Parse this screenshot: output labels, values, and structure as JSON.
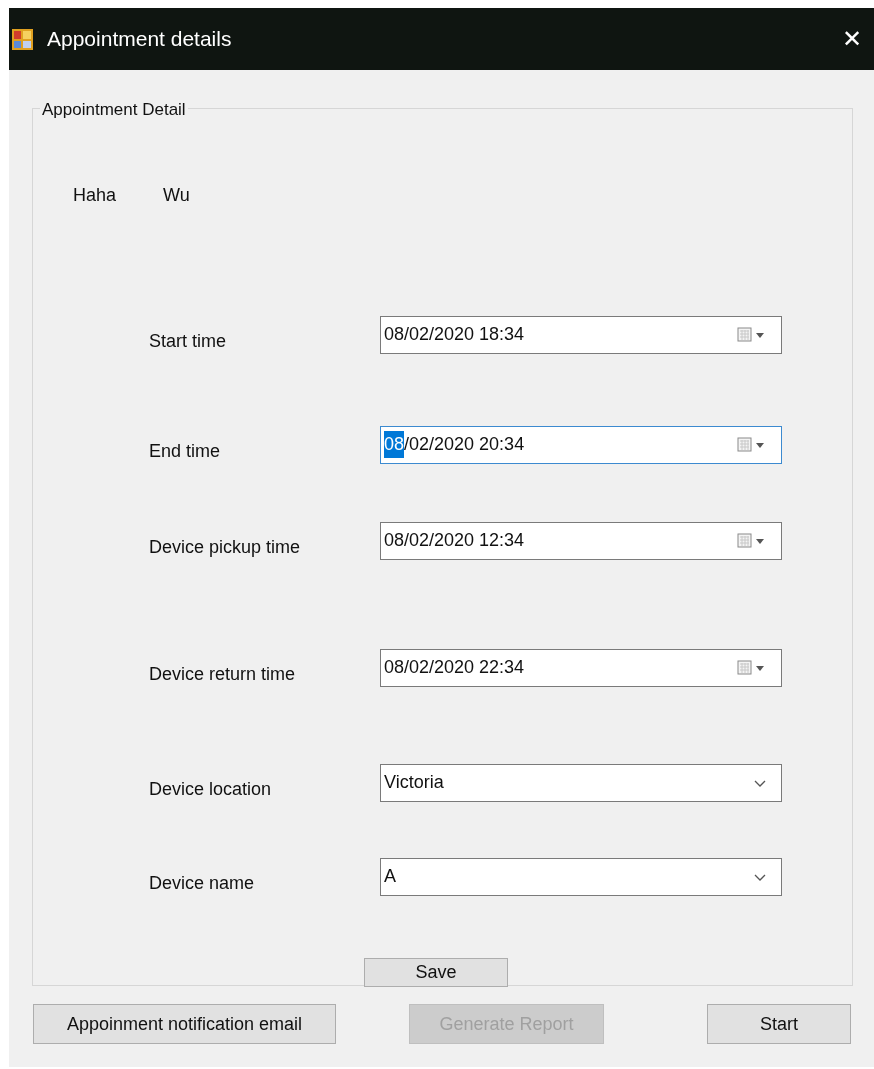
{
  "window": {
    "title": "Appointment details",
    "close": "✕"
  },
  "group": {
    "title": "Appointment Detail",
    "names": [
      "Haha",
      "Wu"
    ],
    "fields": [
      {
        "kind": "datetime",
        "label": "Start time",
        "focused": false,
        "segments": [
          {
            "text": "08/02/2020 18:34",
            "selected": false
          }
        ]
      },
      {
        "kind": "datetime",
        "label": "End time",
        "focused": true,
        "segments": [
          {
            "text": "08",
            "selected": true
          },
          {
            "text": "/02/2020 20:34",
            "selected": false
          }
        ]
      },
      {
        "kind": "datetime",
        "label": "Device pickup time",
        "focused": false,
        "segments": [
          {
            "text": "08/02/2020 12:34",
            "selected": false
          }
        ]
      },
      {
        "kind": "datetime",
        "label": "Device return time",
        "focused": false,
        "segments": [
          {
            "text": "08/02/2020 22:34",
            "selected": false
          }
        ]
      },
      {
        "kind": "combo",
        "label": "Device location",
        "focused": false,
        "segments": [
          {
            "text": "Victoria",
            "selected": false
          }
        ]
      },
      {
        "kind": "combo",
        "label": "Device name",
        "focused": false,
        "segments": [
          {
            "text": "A",
            "selected": false
          }
        ]
      }
    ],
    "save": {
      "label": "Save",
      "disabled": false
    }
  },
  "buttons": [
    {
      "label": "Appoinment notification email",
      "disabled": false
    },
    {
      "label": "Generate Report",
      "disabled": true
    },
    {
      "label": "Start",
      "disabled": false
    }
  ]
}
